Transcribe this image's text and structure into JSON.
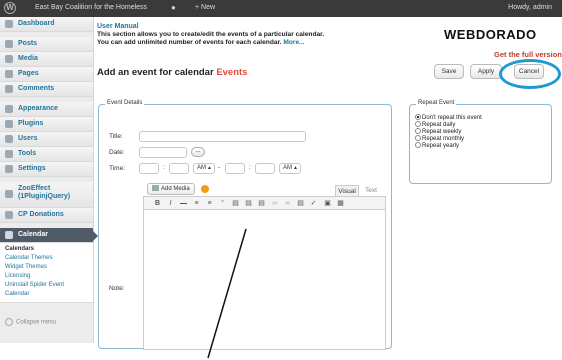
{
  "adminbar": {
    "site_name": "East Bay Coalition for the Homeless",
    "comments_icon": "speech-bubble-icon",
    "new_label": "+ New",
    "howdy": "Howdy, admin"
  },
  "sidebar": {
    "items": [
      {
        "label": "Dashboard",
        "icon": "dashboard-icon"
      },
      {
        "label": "Posts",
        "icon": "pin-icon"
      },
      {
        "label": "Media",
        "icon": "media-icon"
      },
      {
        "label": "Pages",
        "icon": "pages-icon"
      },
      {
        "label": "Comments",
        "icon": "comments-icon"
      },
      {
        "label": "Appearance",
        "icon": "appearance-icon"
      },
      {
        "label": "Plugins",
        "icon": "plugin-icon"
      },
      {
        "label": "Users",
        "icon": "users-icon"
      },
      {
        "label": "Tools",
        "icon": "tools-icon"
      },
      {
        "label": "Settings",
        "icon": "settings-icon"
      },
      {
        "label": "ZooEffect (1PluginjQuery)",
        "icon": "plugin-icon"
      },
      {
        "label": "CP Donations",
        "icon": "plugin-icon"
      },
      {
        "label": "Calendar",
        "icon": "calendar-icon"
      }
    ],
    "submenu": [
      "Calendars",
      "Calendar Themes",
      "Widget Themes",
      "Licensing",
      "Uninstall Spider Event Calendar"
    ],
    "collapse": "Collapse menu"
  },
  "manual": {
    "title": "User Manual",
    "line1": "This section allows you to create/edit the events of a particular calendar.",
    "line2": "You can add unlimited number of events for each calendar.",
    "more": "More..."
  },
  "logo": {
    "text": "WEBDORADO",
    "full_version": "Get the full version"
  },
  "page_title": {
    "prefix": "Add an event for calendar",
    "calendar": "Events"
  },
  "buttons": {
    "save": "Save",
    "apply": "Apply",
    "cancel": "Cancel"
  },
  "event_details": {
    "legend": "Event Details",
    "title_label": "Title:",
    "date_label": "Date:",
    "date_button": "...",
    "time_label": "Time:",
    "ampm1": "AM",
    "ampm2": "AM",
    "time_dash": "-",
    "add_media": "Add Media",
    "tab_visual": "Visual",
    "tab_text": "Text",
    "note_label": "Note:"
  },
  "toolbar_icons": [
    "bold-icon",
    "italic-icon",
    "strikethrough-icon",
    "bullet-list-icon",
    "numbered-list-icon",
    "blockquote-icon",
    "align-left-icon",
    "align-center-icon",
    "align-right-icon",
    "link-icon",
    "unlink-icon",
    "more-tag-icon",
    "spellcheck-icon",
    "fullscreen-icon",
    "kitchen-sink-icon"
  ],
  "repeat_event": {
    "legend": "Repeat Event",
    "options": [
      "Don't repeat this event",
      "Repeat daily",
      "Repeat weekly",
      "Repeat monthly",
      "Repeat yearly"
    ],
    "selected_index": 0
  },
  "colors": {
    "accent_link": "#21759b",
    "annotation_circle": "#1d9bd1",
    "calendar_name": "#e74c3c",
    "admin_bar": "#3a3a3a"
  }
}
